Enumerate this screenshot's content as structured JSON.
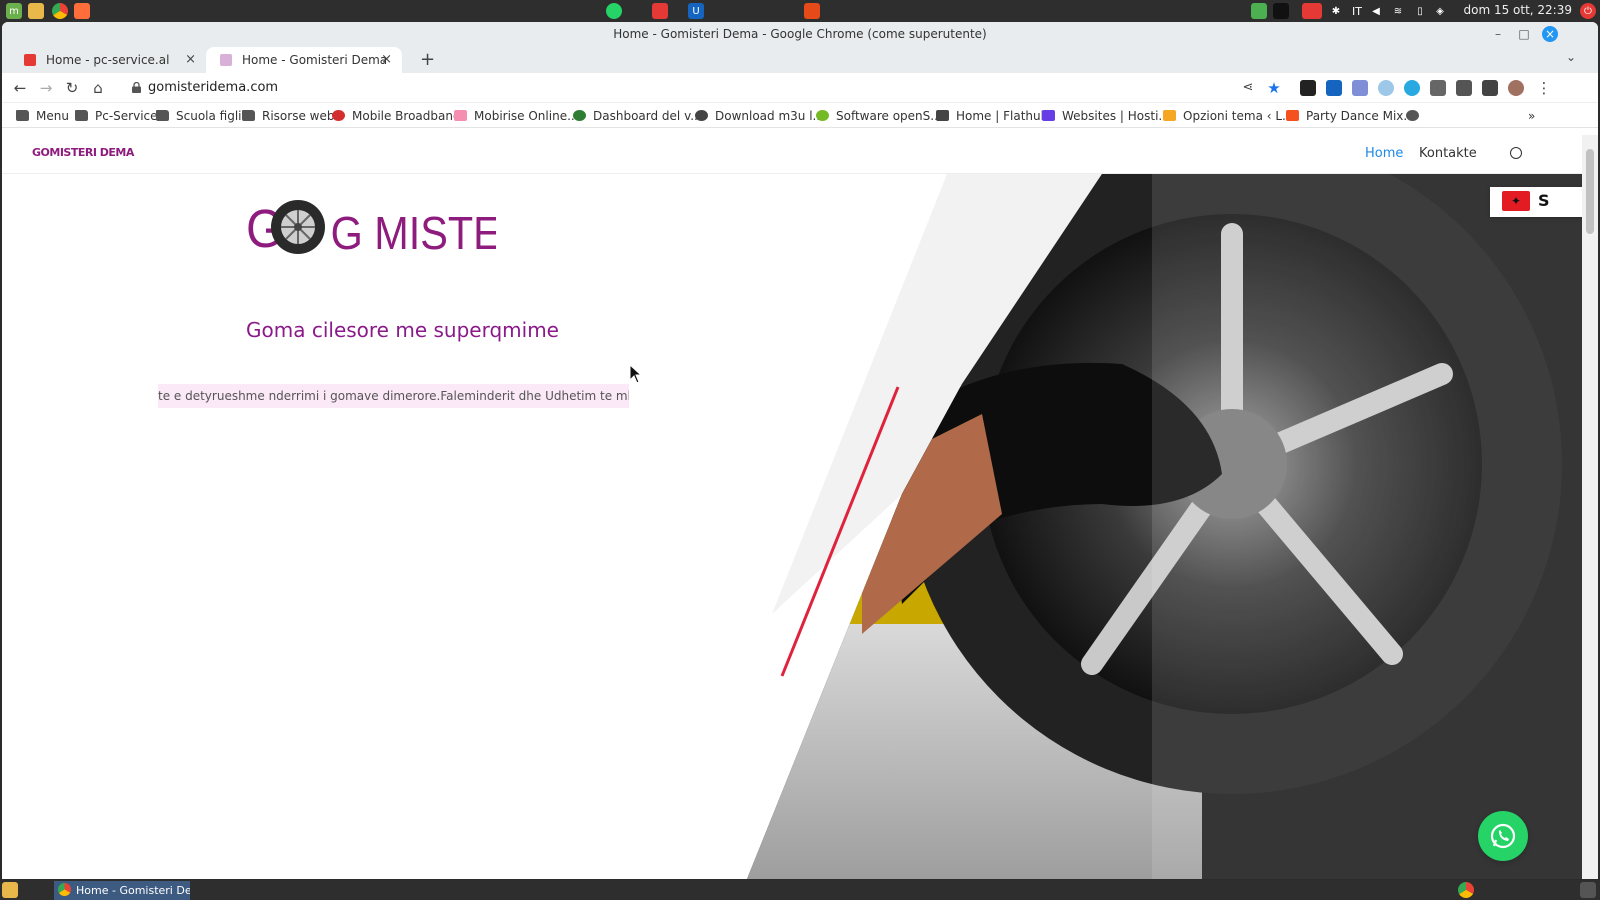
{
  "os": {
    "clock": "dom 15 ott, 22:39",
    "keyboard_layout": "IT"
  },
  "window": {
    "title": "Home - Gomisteri Dema - Google Chrome (come superutente)"
  },
  "tabs": [
    {
      "label": "Home - pc-service.al",
      "favicon_color": "#e53935"
    },
    {
      "label": "Home - Gomisteri Dema",
      "favicon_color": "#b07ab0"
    }
  ],
  "address_bar": {
    "url": "gomisteridema.com"
  },
  "bookmarks": [
    {
      "label": "Menu",
      "icon": "folder-icon"
    },
    {
      "label": "Pc-Service",
      "icon": "folder-icon"
    },
    {
      "label": "Scuola figli",
      "icon": "folder-icon"
    },
    {
      "label": "Risorse web",
      "icon": "folder-icon"
    },
    {
      "label": "Mobile Broadband",
      "icon": "huawei-icon"
    },
    {
      "label": "Mobirise Online...",
      "icon": "mobirise-icon"
    },
    {
      "label": "Dashboard del v...",
      "icon": "dashboard-icon"
    },
    {
      "label": "Download m3u l...",
      "icon": "globe-icon"
    },
    {
      "label": "Software openS...",
      "icon": "opensuse-icon"
    },
    {
      "label": "Home | Flathub",
      "icon": "flathub-icon"
    },
    {
      "label": "Websites | Hosti...",
      "icon": "hostinger-icon"
    },
    {
      "label": "Opzioni tema ‹ L...",
      "icon": "wordpress-icon"
    },
    {
      "label": "Party Dance Mix...",
      "icon": "music-icon"
    }
  ],
  "site": {
    "small_logo": "GOMISTERI DEMA",
    "nav": {
      "home": "Home",
      "contact": "Kontakte"
    },
    "big_logo": "G MISTERI DEMA",
    "hero_title": "Goma cilesore me superqmime",
    "marquee_text": "te e detyrueshme nderrimi i gomave dimerore.Faleminderit dhe Udhetim te mbare.",
    "lang_text": "S"
  },
  "taskbar": {
    "active_task": "Home - Gomisteri De..."
  }
}
